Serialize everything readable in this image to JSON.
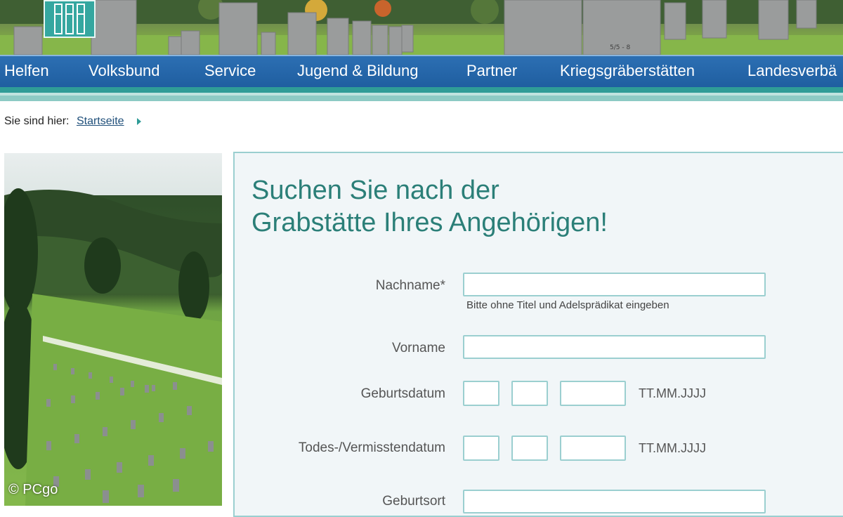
{
  "header": {
    "logo_icon": "volksbund-logo-icon",
    "headstone_marking": "5/5 - 8"
  },
  "nav": {
    "items": [
      {
        "label": "Helfen"
      },
      {
        "label": "Volksbund"
      },
      {
        "label": "Service"
      },
      {
        "label": "Jugend & Bildung"
      },
      {
        "label": "Partner"
      },
      {
        "label": "Kriegsgräberstätten"
      },
      {
        "label": "Landesverbä"
      }
    ]
  },
  "breadcrumb": {
    "prefix": "Sie sind hier:",
    "home_link": "Startseite",
    "separator_icon": "triangle-right-icon"
  },
  "search": {
    "title_line1": "Suchen Sie nach der",
    "title_line2": "Grabstätte Ihres Angehörigen!",
    "fields": {
      "lastname": {
        "label": "Nachname*",
        "value": "",
        "hint": "Bitte ohne Titel und Adelsprädikat eingeben"
      },
      "firstname": {
        "label": "Vorname",
        "value": ""
      },
      "birthdate": {
        "label": "Geburtsdatum",
        "day": "",
        "month": "",
        "year": "",
        "format": "TT.MM.JJJJ"
      },
      "deathdate": {
        "label": "Todes-/Vermisstendatum",
        "day": "",
        "month": "",
        "year": "",
        "format": "TT.MM.JJJJ"
      },
      "birthplace": {
        "label": "Geburtsort",
        "value": ""
      }
    }
  },
  "watermark": "© PCgo",
  "colors": {
    "nav_blue": "#2c6fb3",
    "teal_accent": "#2f9c97",
    "title_teal": "#2b7f78",
    "input_border": "#9bcfd0",
    "panel_bg": "#f1f6f8"
  }
}
